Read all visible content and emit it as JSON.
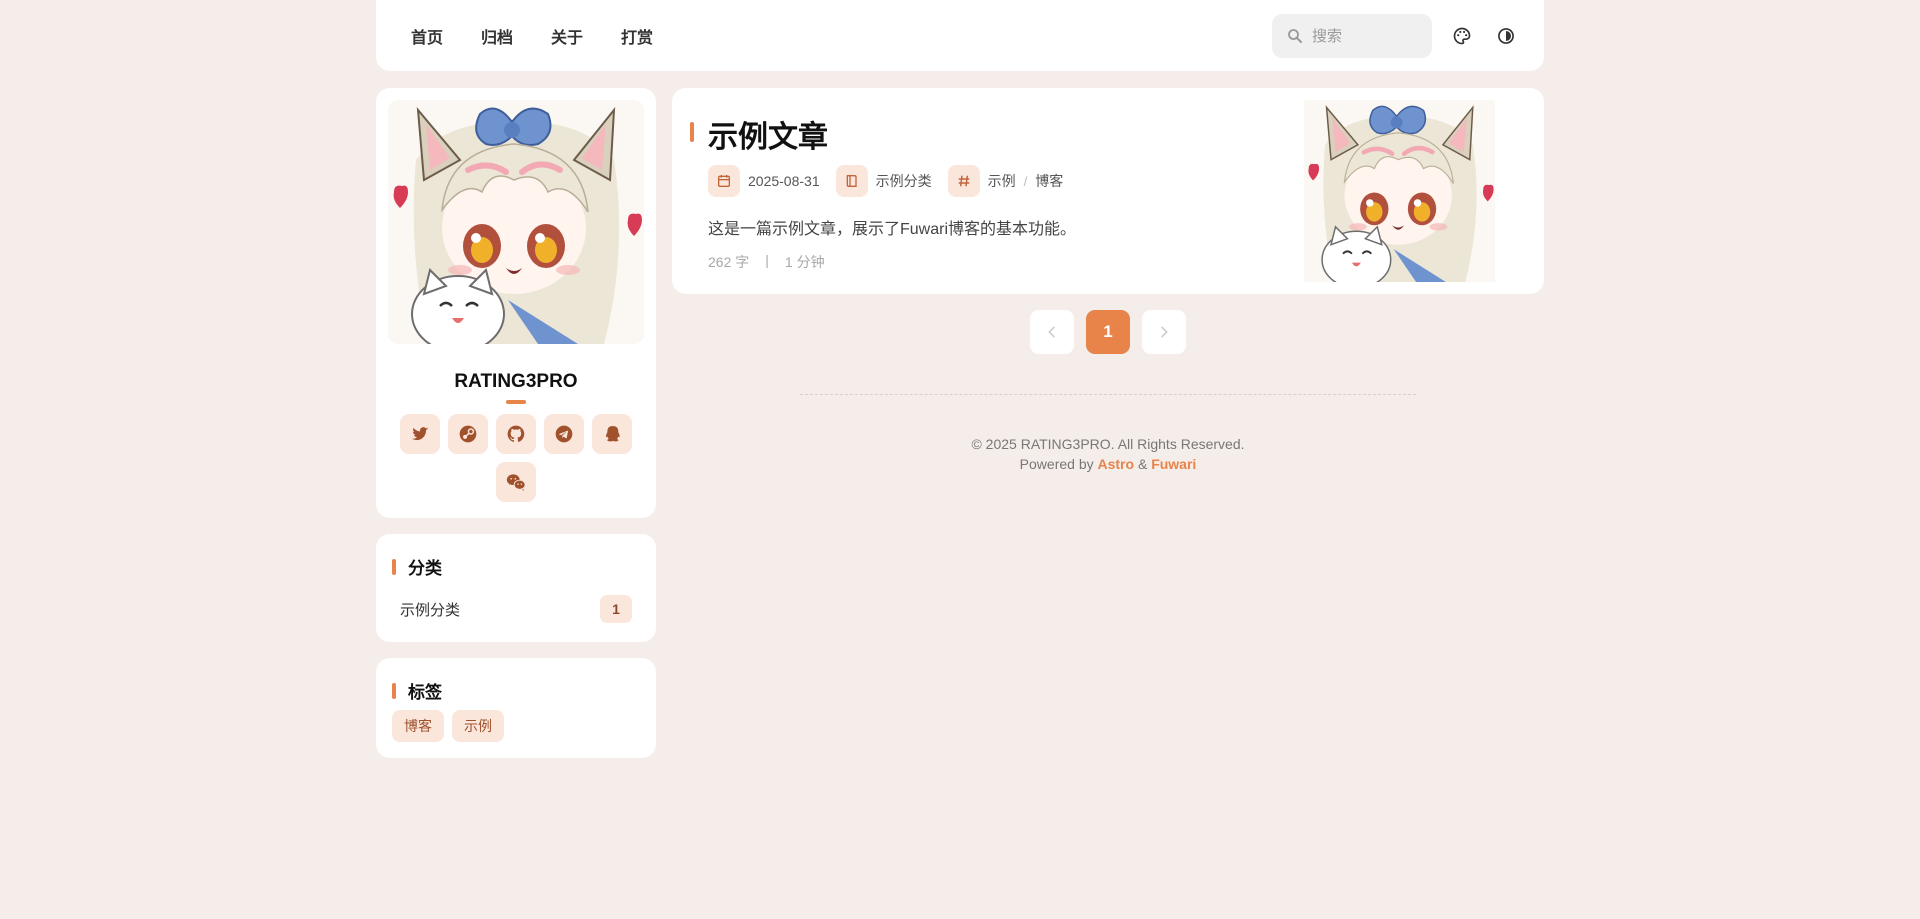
{
  "nav": {
    "links": [
      "首页",
      "归档",
      "关于",
      "打赏"
    ],
    "search_placeholder": "搜索",
    "icons": [
      "palette-icon",
      "theme-toggle-icon"
    ]
  },
  "profile": {
    "name": "RATING3PRO",
    "socials": [
      "twitter-icon",
      "steam-icon",
      "github-icon",
      "telegram-icon",
      "qq-icon",
      "wechat-icon"
    ]
  },
  "category_widget": {
    "title": "分类",
    "items": [
      {
        "name": "示例分类",
        "count": "1"
      }
    ]
  },
  "tag_widget": {
    "title": "标签",
    "tags": [
      "博客",
      "示例"
    ]
  },
  "post": {
    "title": "示例文章",
    "date": "2025-08-31",
    "category": "示例分类",
    "tags": [
      "示例",
      "博客"
    ],
    "tag_separator": "/",
    "description": "这是一篇示例文章，展示了Fuwari博客的基本功能。",
    "word_count": "262 字",
    "stat_separator": "|",
    "read_time": "1 分钟"
  },
  "pagination": {
    "current": "1"
  },
  "footer": {
    "copyright": "© 2025 RATING3PRO. All Rights Reserved.",
    "powered_prefix": "Powered by",
    "powered_astro": "Astro",
    "powered_and": "&",
    "powered_fuwari": "Fuwari"
  },
  "colors": {
    "accent": "#e8834a",
    "accent_soft": "#fbe6dc",
    "page_bg": "#f5ede9"
  }
}
